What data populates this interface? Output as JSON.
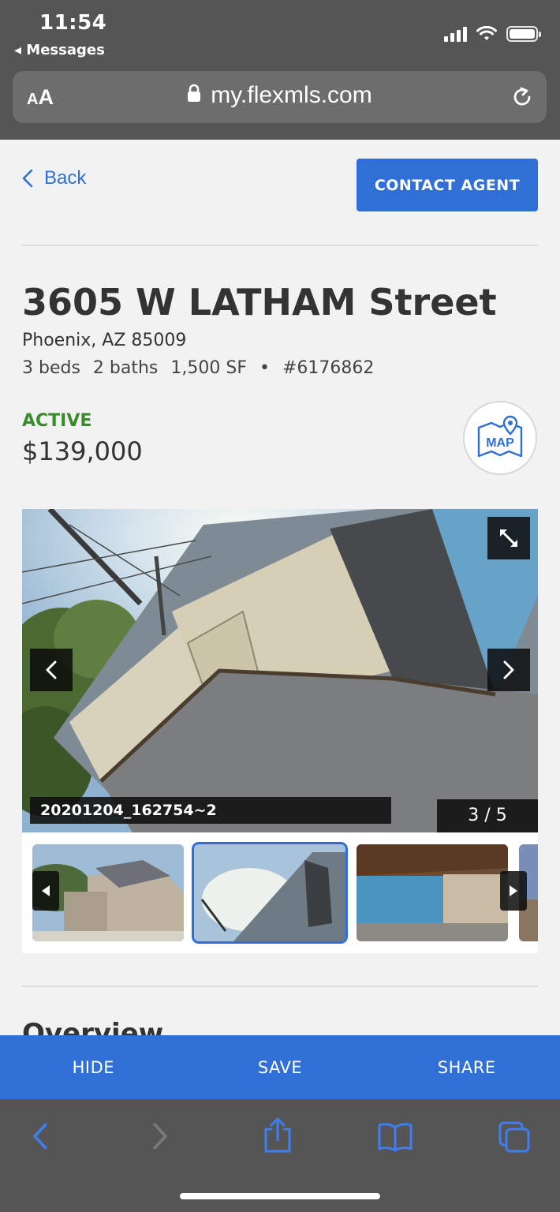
{
  "status_bar": {
    "time": "11:54",
    "back_app": "◂ Messages"
  },
  "browser": {
    "text_size_small": "A",
    "text_size_large": "A",
    "url": "my.flexmls.com"
  },
  "header": {
    "back_label": "Back",
    "contact_label": "CONTACT AGENT"
  },
  "listing": {
    "street": "3605 W LATHAM Street",
    "city_state_zip": "Phoenix, AZ 85009",
    "beds": "3 beds",
    "baths": "2 baths",
    "area": "1,500 SF",
    "separator": "•",
    "mls_number": "#6176862",
    "status": "ACTIVE",
    "price": "$139,000",
    "map_label": "MAP"
  },
  "gallery": {
    "caption": "20201204_162754~2",
    "counter": "3 / 5",
    "selected_thumbnail": 2
  },
  "section": {
    "overview_title": "Overview"
  },
  "actions": {
    "hide": "HIDE",
    "save": "SAVE",
    "share": "SHARE"
  },
  "colors": {
    "accent": "#2f6fd6",
    "active_status": "#3b8a2e",
    "chrome": "#555555"
  }
}
